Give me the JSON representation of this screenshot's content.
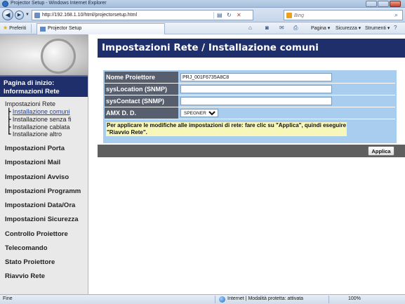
{
  "window": {
    "title": "Projector Setup - Windows Internet Explorer"
  },
  "address_bar": {
    "url": "http://192.168.1.10/html/projectorsetup.html",
    "search_placeholder": "Bing"
  },
  "favorites_bar": {
    "favorites_label": "Preferiti",
    "tab_label": "Projector Setup",
    "commands": {
      "page": "Pagina ▾",
      "security": "Sicurezza ▾",
      "tools": "Strumenti ▾"
    }
  },
  "sidebar": {
    "home_line1": "Pagina di inizio:",
    "home_line2": "Informazioni Rete",
    "section": "Impostazioni Rete",
    "subitems": [
      "Installazione comuni",
      "Installazione senza fi",
      "Installazione cablata",
      "Installazione altro"
    ],
    "items": [
      "Impostazioni Porta",
      "Impostazioni Mail",
      "Impostazioni Avviso",
      "Impostazioni Programm",
      "Impostazioni Data/Ora",
      "Impostazioni Sicurezza",
      "Controllo Proiettore",
      "Telecomando",
      "Stato Proiettore",
      "Riavvio Rete"
    ]
  },
  "main": {
    "heading": "Impostazioni Rete / Installazione comuni",
    "rows": [
      {
        "label": "Nome Proiettore",
        "value": "PRJ_001F6735A8C8"
      },
      {
        "label": "sysLocation (SNMP)",
        "value": ""
      },
      {
        "label": "sysContact (SNMP)",
        "value": ""
      },
      {
        "label": "AMX D. D.",
        "value": "SPEGNERE"
      }
    ],
    "note_line1": "Per applicare le modifiche alle impostazioni di rete: fare clic su \"Applica\", quindi eseguire",
    "note_line2": "\"Riavvio Rete\".",
    "apply_label": "Applica"
  },
  "status_bar": {
    "left": "Fine",
    "zone": "Internet | Modalità protetta: attivata",
    "zoom": "100%"
  }
}
